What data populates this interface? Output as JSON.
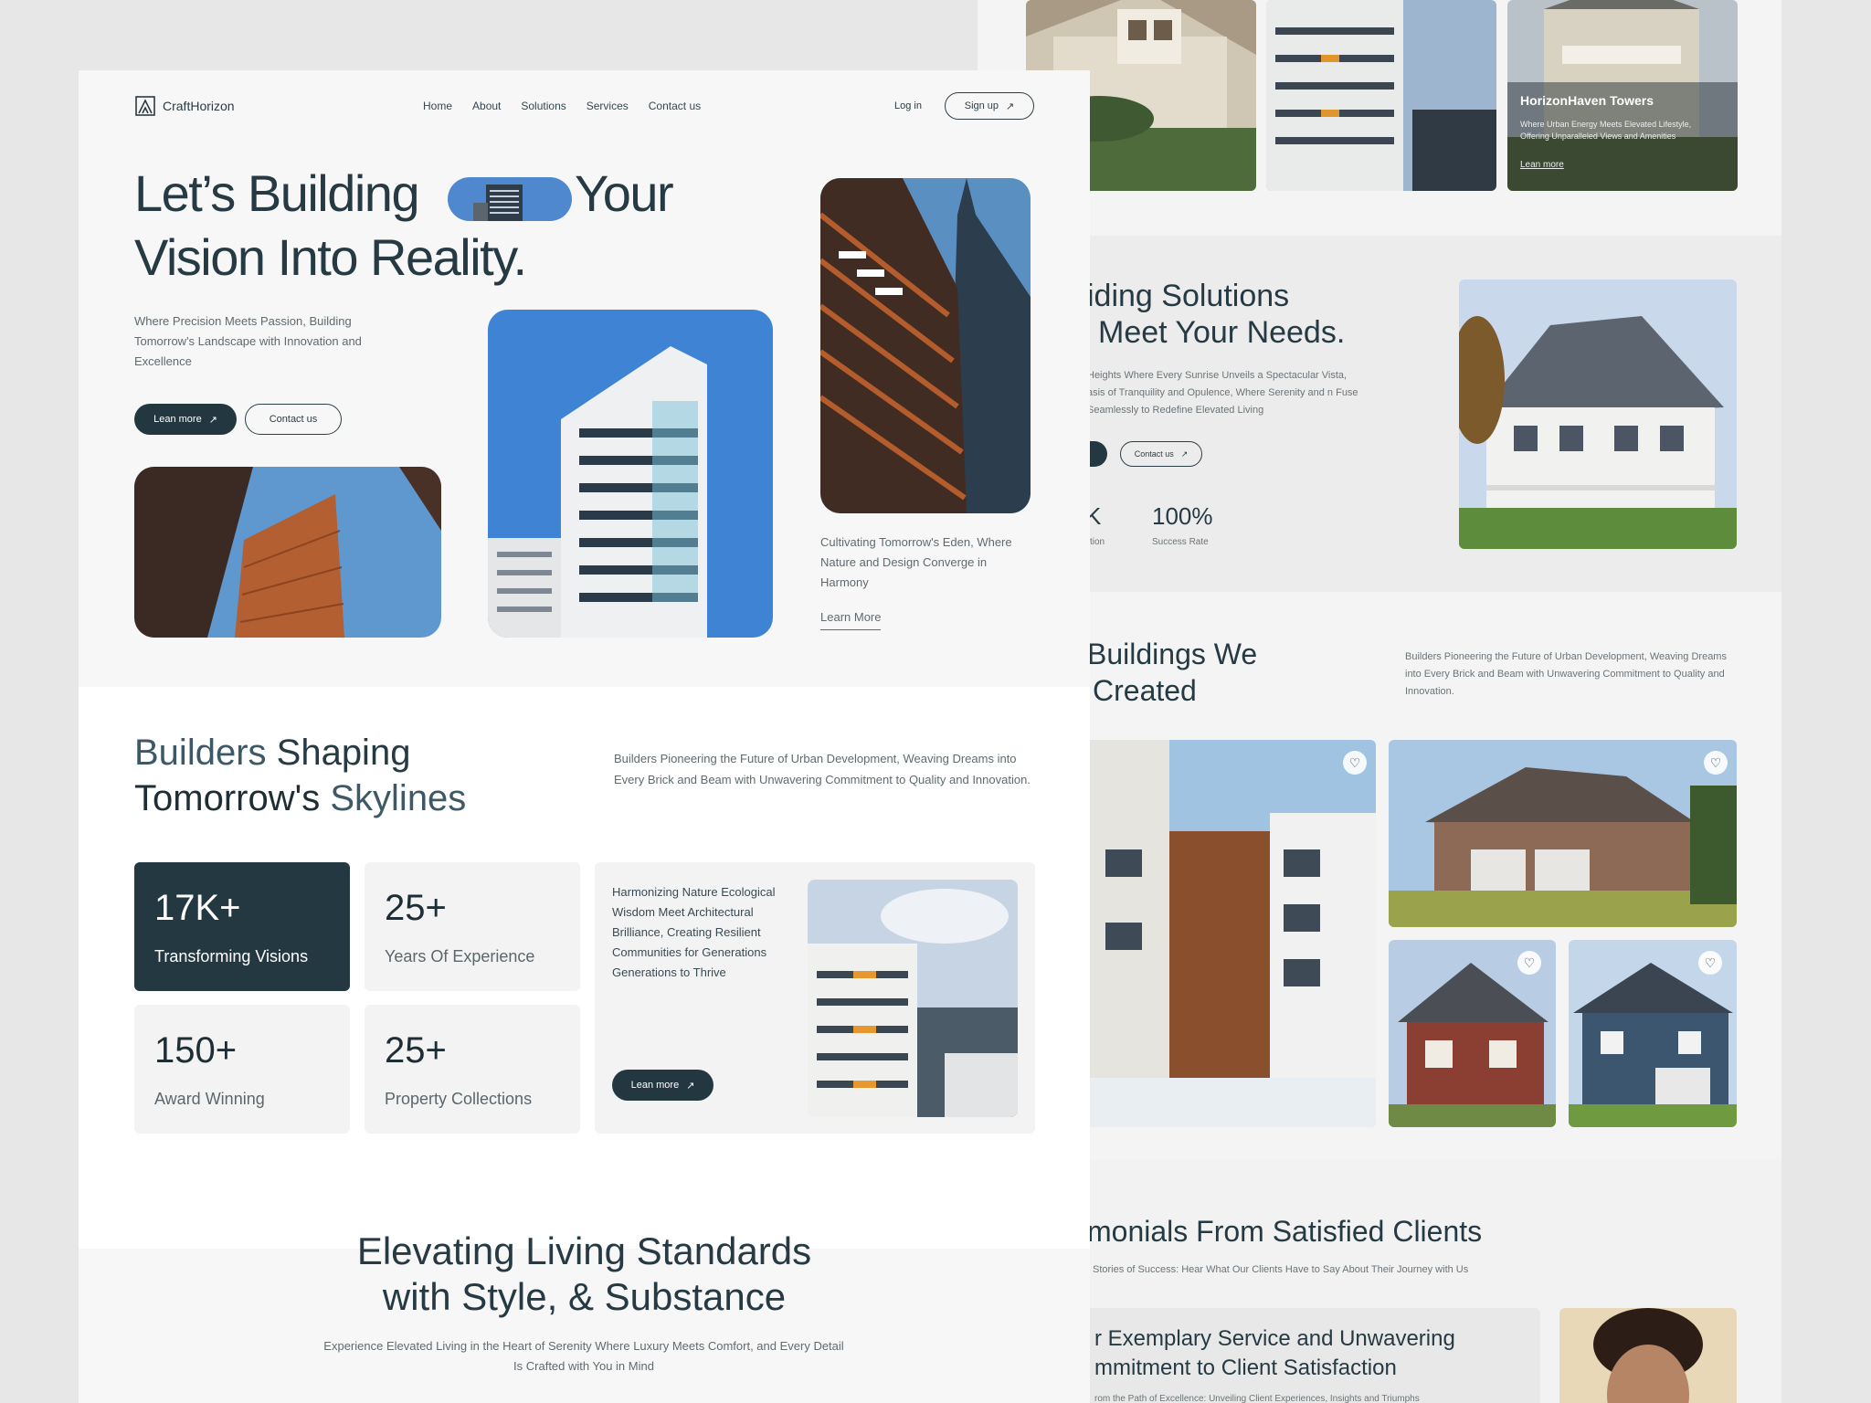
{
  "brand": {
    "name": "CraftHorizon"
  },
  "nav": {
    "items": [
      "Home",
      "About",
      "Solutions",
      "Services",
      "Contact us"
    ],
    "login": "Log in",
    "signup": "Sign up"
  },
  "hero": {
    "title_part1": "Let’s Building",
    "title_part2": "Your",
    "title_line2": "Vision Into Reality.",
    "subtitle": "Where Precision Meets Passion, Building Tomorrow's Landscape with Innovation and Excellence",
    "btn_learn": "Lean more",
    "btn_contact": "Contact us",
    "caption": "Cultivating Tomorrow's Eden, Where Nature and Design Converge in Harmony",
    "learn_more_link": "Learn More"
  },
  "builders": {
    "title_a": "Builders",
    "title_b": "Shaping",
    "title_c": "Tomorrow's",
    "title_d": "Skylines",
    "desc": "Builders Pioneering the Future of Urban Development, Weaving Dreams into Every Brick and Beam with Unwavering Commitment to Quality and Innovation.",
    "stats": [
      {
        "num": "17K+",
        "label": "Transforming Visions"
      },
      {
        "num": "25+",
        "label": "Years Of Experience"
      },
      {
        "num": "150+",
        "label": "Award Winning"
      },
      {
        "num": "25+",
        "label": "Property Collections"
      }
    ],
    "feature_text": "Harmonizing Nature Ecological Wisdom Meet Architectural Brilliance, Creating Resilient Communities for Generations Generations to Thrive",
    "feature_btn": "Lean more"
  },
  "elevating": {
    "title_line1": "Elevating Living Standards",
    "title_line2": "with Style, & Substance",
    "desc": "Experience Elevated Living in the Heart of Serenity Where Luxury Meets Comfort, and Every Detail Is Crafted with You in Mind"
  },
  "bg": {
    "tower_title": "HorizonHaven Towers",
    "tower_desc": "Where Urban Energy Meets Elevated Lifestyle, Offering Unparalleled Views and Amenities",
    "tower_link": "Lean more",
    "solutions_title1": "iding Solutions",
    "solutions_title2": "Meet Your Needs.",
    "solutions_desc": "Heights Where Every Sunrise Unveils a Spectacular Vista, asis of Tranquility and Opulence, Where Serenity and n Fuse Seamlessly to Redefine Elevated Living",
    "solutions_contact": "Contact us",
    "stat_partial_num": "K",
    "stat_partial_label": "ction",
    "stat_num": "100%",
    "stat_label": "Success Rate",
    "buildings_title1": "Buildings We",
    "buildings_title2": "Created",
    "buildings_desc": "Builders Pioneering the Future of Urban Development, Weaving Dreams into Every Brick and Beam with Unwavering Commitment to Quality and Innovation.",
    "testimonials_title": "monials From Satisfied Clients",
    "testimonials_sub": "Stories of Success: Hear What Our Clients Have to Say About Their Journey with Us",
    "quote_line1": "r Exemplary Service and Unwavering",
    "quote_line2": "mmitment to Client Satisfaction",
    "quote_small": "rom the Path of Excellence: Unveiling Client Experiences, Insights and Triumphs"
  },
  "icons": {
    "logo": "logo-icon",
    "arrow": "arrow-up-right-icon",
    "heart": "heart-icon"
  },
  "colors": {
    "primary": "#243841",
    "bg": "#f7f7f7",
    "accent_blue": "#4a82c8"
  }
}
